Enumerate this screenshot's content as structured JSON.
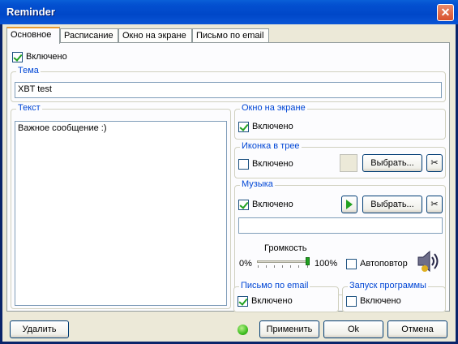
{
  "window": {
    "title": "Reminder"
  },
  "tabs": [
    "Основное",
    "Расписание",
    "Окно на экране",
    "Письмо по email"
  ],
  "enabled": {
    "label": "Включено",
    "checked": true
  },
  "subject": {
    "legend": "Тема",
    "value": "XBT test"
  },
  "text": {
    "legend": "Текст",
    "value": "Важное сообщение :)"
  },
  "screen_window": {
    "legend": "Окно на экране",
    "enabled_label": "Включено",
    "checked": true
  },
  "tray_icon": {
    "legend": "Иконка в трее",
    "enabled_label": "Включено",
    "checked": false,
    "choose_label": "Выбрать...",
    "clear_icon": "scissors-icon"
  },
  "music": {
    "legend": "Музыка",
    "enabled_label": "Включено",
    "checked": true,
    "play_icon": "play-icon",
    "choose_label": "Выбрать...",
    "clear_icon": "scissors-icon",
    "file_value": "",
    "volume_label": "Громкость",
    "volume_min": "0%",
    "volume_max": "100%",
    "volume_level": 1.0,
    "autorepeat_label": "Автоповтор",
    "autorepeat_checked": false,
    "speaker_icon": "speaker-icon"
  },
  "email": {
    "legend": "Письмо по email",
    "enabled_label": "Включено",
    "checked": true
  },
  "run_program": {
    "legend": "Запуск программы",
    "enabled_label": "Включено",
    "checked": false
  },
  "footer": {
    "delete_label": "Удалить",
    "apply_label": "Применить",
    "ok_label": "Ok",
    "cancel_label": "Отмена",
    "status_color": "#3fbf20"
  }
}
